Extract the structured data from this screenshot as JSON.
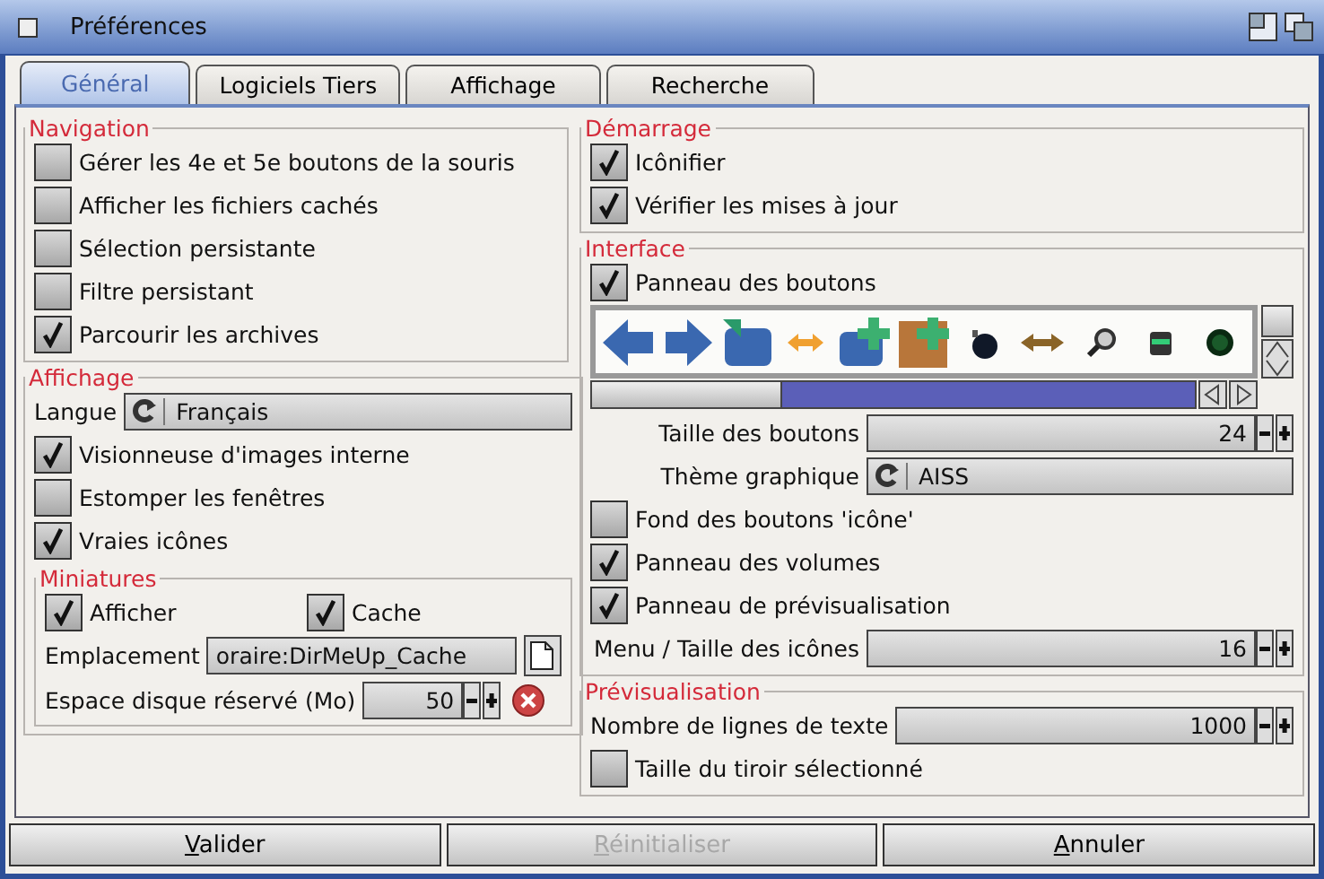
{
  "window": {
    "title": "Préférences"
  },
  "tabs": [
    {
      "label": "Général",
      "selected": true
    },
    {
      "label": "Logiciels Tiers",
      "selected": false
    },
    {
      "label": "Affichage",
      "selected": false
    },
    {
      "label": "Recherche",
      "selected": false
    }
  ],
  "left_groups": [
    {
      "title": "Navigation",
      "rows": [
        {
          "kind": "checkbox",
          "label": "Gérer les 4e et 5e boutons de la souris",
          "checked": false
        },
        {
          "kind": "checkbox",
          "label": "Afficher les fichiers cachés",
          "checked": false
        },
        {
          "kind": "checkbox",
          "label": "Sélection persistante",
          "checked": false
        },
        {
          "kind": "checkbox",
          "label": "Filtre persistant",
          "checked": false
        },
        {
          "kind": "checkbox",
          "label": "Parcourir les archives",
          "checked": true
        }
      ]
    },
    {
      "title": "Affichage",
      "rows": [
        {
          "kind": "cycle",
          "label": "Langue",
          "value": "Français"
        },
        {
          "kind": "checkbox",
          "label": "Visionneuse d'images interne",
          "checked": true
        },
        {
          "kind": "checkbox",
          "label": "Estomper les fenêtres",
          "checked": false
        },
        {
          "kind": "checkbox",
          "label": "Vraies icônes",
          "checked": true
        },
        {
          "kind": "group",
          "title": "Miniatures",
          "rows": [
            {
              "kind": "checkbox_pair",
              "items": [
                {
                  "label": "Afficher",
                  "checked": true
                },
                {
                  "label": "Cache",
                  "checked": true
                }
              ]
            },
            {
              "kind": "path",
              "label": "Emplacement",
              "value": "oraire:DirMeUp_Cache"
            },
            {
              "kind": "spinner",
              "label": "Espace disque réservé (Mo)",
              "value": "50",
              "clear_button": true
            }
          ]
        }
      ]
    }
  ],
  "right_groups": [
    {
      "title": "Démarrage",
      "rows": [
        {
          "kind": "checkbox",
          "label": "Icônifier",
          "checked": true
        },
        {
          "kind": "checkbox",
          "label": "Vérifier les mises à jour",
          "checked": true
        }
      ]
    },
    {
      "title": "Interface",
      "rows": [
        {
          "kind": "checkbox",
          "label": "Panneau des boutons",
          "checked": true
        },
        {
          "kind": "toolbar"
        },
        {
          "kind": "spinner",
          "label": "Taille des boutons",
          "value": "24",
          "clear_button": false
        },
        {
          "kind": "cycle",
          "label": "Thème graphique",
          "value": "AISS"
        },
        {
          "kind": "checkbox",
          "label": "Fond des boutons 'icône'",
          "checked": false
        },
        {
          "kind": "checkbox",
          "label": "Panneau des volumes",
          "checked": true
        },
        {
          "kind": "checkbox",
          "label": "Panneau de prévisualisation",
          "checked": true
        },
        {
          "kind": "spinner",
          "label": "Menu / Taille des icônes",
          "value": "16",
          "clear_button": false
        }
      ]
    },
    {
      "title": "Prévisualisation",
      "rows": [
        {
          "kind": "spinner",
          "label": "Nombre de lignes de texte",
          "value": "1000",
          "clear_button": false
        },
        {
          "kind": "checkbox",
          "label": "Taille du tiroir sélectionné",
          "checked": false
        }
      ]
    }
  ],
  "buttons": [
    {
      "label": "Valider",
      "disabled": false
    },
    {
      "label": "Réinitialiser",
      "disabled": true
    },
    {
      "label": "Annuler",
      "disabled": false
    }
  ]
}
